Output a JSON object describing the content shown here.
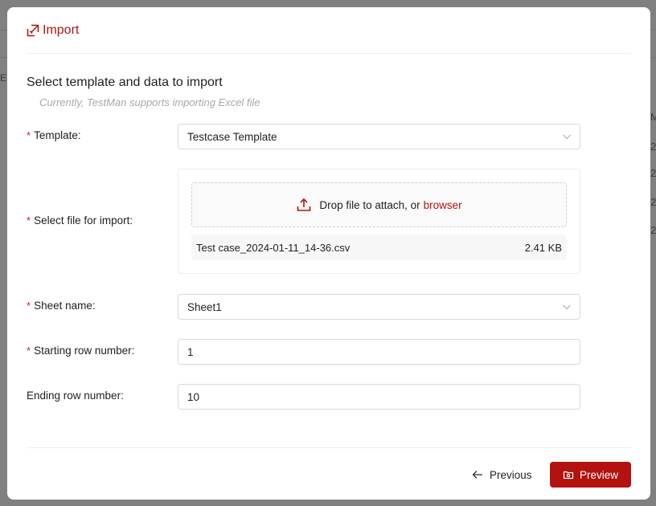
{
  "background": {
    "col_header": "M",
    "row_values": [
      "2",
      "2",
      "2",
      "2"
    ],
    "left_fragment": "E A"
  },
  "modal": {
    "title": "Import",
    "title_icon": "import-icon",
    "accent_color": "#b3120f"
  },
  "section": {
    "title": "Select template and data to import",
    "subtitle": "Currently, TestMan supports importing Excel file"
  },
  "form": {
    "template": {
      "label": "Template:",
      "required": true,
      "value": "Testcase Template"
    },
    "file": {
      "label": "Select file for import:",
      "required": true,
      "drop_text": "Drop file to attach, or",
      "browse_label": "browser",
      "file_name": "Test case_2024-01-11_14-36.csv",
      "file_size": "2.41 KB"
    },
    "sheet": {
      "label": "Sheet name:",
      "required": true,
      "value": "Sheet1"
    },
    "start_row": {
      "label": "Starting row number:",
      "required": true,
      "value": "1"
    },
    "end_row": {
      "label": "Ending row number:",
      "required": false,
      "value": "10"
    }
  },
  "footer": {
    "previous_label": "Previous",
    "preview_label": "Preview"
  }
}
